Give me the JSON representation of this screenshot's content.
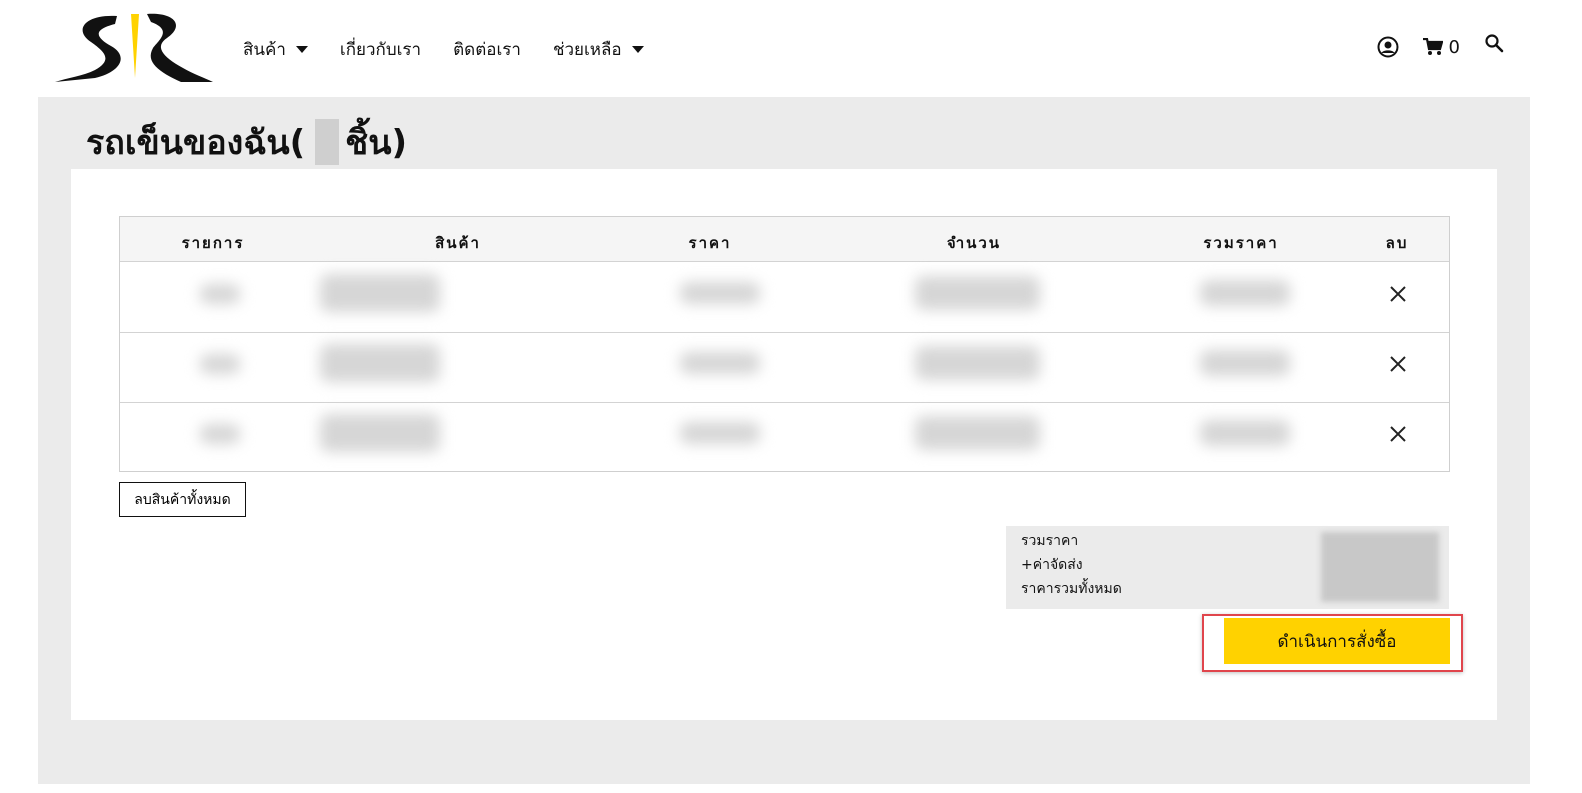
{
  "header": {
    "logo_alt": "SR logo",
    "nav": [
      {
        "label": "สินค้า",
        "has_dropdown": true
      },
      {
        "label": "เกี่ยวกับเรา",
        "has_dropdown": false
      },
      {
        "label": "ติดต่อเรา",
        "has_dropdown": false
      },
      {
        "label": "ช่วยเหลือ",
        "has_dropdown": true
      }
    ],
    "cart_count": "0",
    "icons": [
      "user-icon",
      "cart-icon",
      "search-icon"
    ]
  },
  "page": {
    "title_prefix": "รถเข็นของฉัน(",
    "title_suffix": "ชิ้น)"
  },
  "cart_table": {
    "columns": [
      "รายการ",
      "สินค้า",
      "ราคา",
      "จำนวน",
      "รวมราคา",
      "ลบ"
    ],
    "rows_note_blurred": 3
  },
  "actions": {
    "clear_all_label": "ลบสินค้าทั้งหมด",
    "checkout_label": "ดำเนินการสั่งซื้อ"
  },
  "summary": {
    "subtotal_label": "รวมราคา",
    "shipping_label": "+ค่าจัดส่ง",
    "total_label": "ราคารวมทั้งหมด"
  },
  "colors": {
    "accent": "#ffd200",
    "highlight_border": "#e0454c",
    "band": "#ebebeb"
  }
}
